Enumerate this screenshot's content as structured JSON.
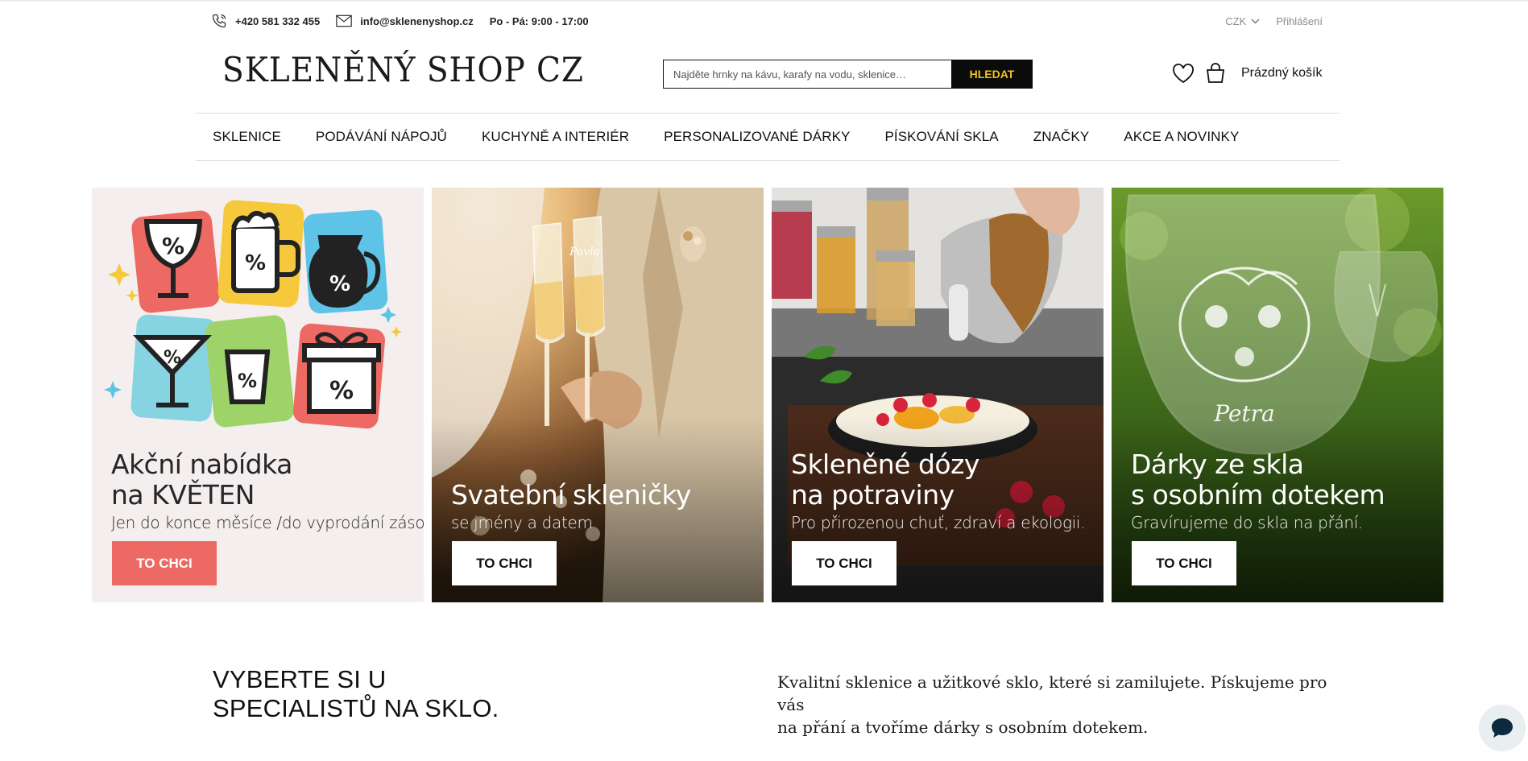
{
  "topbar": {
    "phone": "+420 581 332 455",
    "email": "info@sklenenyshop.cz",
    "hours": "Po - Pá: 9:00 - 17:00",
    "currency": "CZK",
    "login": "Přihlášení"
  },
  "header": {
    "logo": "SKLENĚNÝ SHOP CZ",
    "search_placeholder": "Najděte hrnky na kávu, karafy na vodu, sklenice…",
    "search_button": "HLEDAT",
    "cart_label": "Prázdný košík"
  },
  "nav": {
    "items": [
      {
        "label": "SKLENICE"
      },
      {
        "label": "PODÁVÁNÍ NÁPOJŮ"
      },
      {
        "label": "KUCHYNĚ A INTERIÉR"
      },
      {
        "label": "PERSONALIZOVANÉ DÁRKY"
      },
      {
        "label": "PÍSKOVÁNÍ SKLA"
      },
      {
        "label": "ZNAČKY"
      },
      {
        "label": "AKCE A NOVINKY"
      }
    ]
  },
  "banners": [
    {
      "title_line1": "Akční nabídka",
      "title_line2": "na KVĚTEN",
      "subtitle": "Jen do konce měsíce /do vyprodání zásob.",
      "button": "TO CHCI",
      "percent": "%"
    },
    {
      "title_line1": "",
      "title_line2": "Svatební skleničky",
      "subtitle": "se jmény a datem",
      "button": "TO CHCI",
      "engraving": "Pavla"
    },
    {
      "title_line1": "Skleněné dózy",
      "title_line2": "na potraviny",
      "subtitle": "Pro přirozenou chuť, zdraví a ekologii.",
      "button": "TO CHCI"
    },
    {
      "title_line1": "Dárky ze skla",
      "title_line2": "s osobním dotekem",
      "subtitle": "Gravírujeme do skla na přání.",
      "button": "TO CHCI",
      "engraving": "Petra"
    }
  ],
  "intro": {
    "heading_line1": "VYBERTE SI U",
    "heading_line2": "SPECIALISTŮ NA SKLO.",
    "text_line1": "Kvalitní sklenice a užitkové sklo, které si zamilujete. Pískujeme pro vás",
    "text_line2": "na přání a tvoříme dárky s osobním dotekem."
  },
  "colors": {
    "accent_yellow": "#f0c419",
    "promo_red": "#ec6a63",
    "card1_bg": "#f4eeee"
  },
  "icons": {
    "phone": "phone-icon",
    "email": "mail-icon",
    "wishlist": "heart-icon",
    "cart": "bag-icon",
    "chat": "chat-icon"
  }
}
